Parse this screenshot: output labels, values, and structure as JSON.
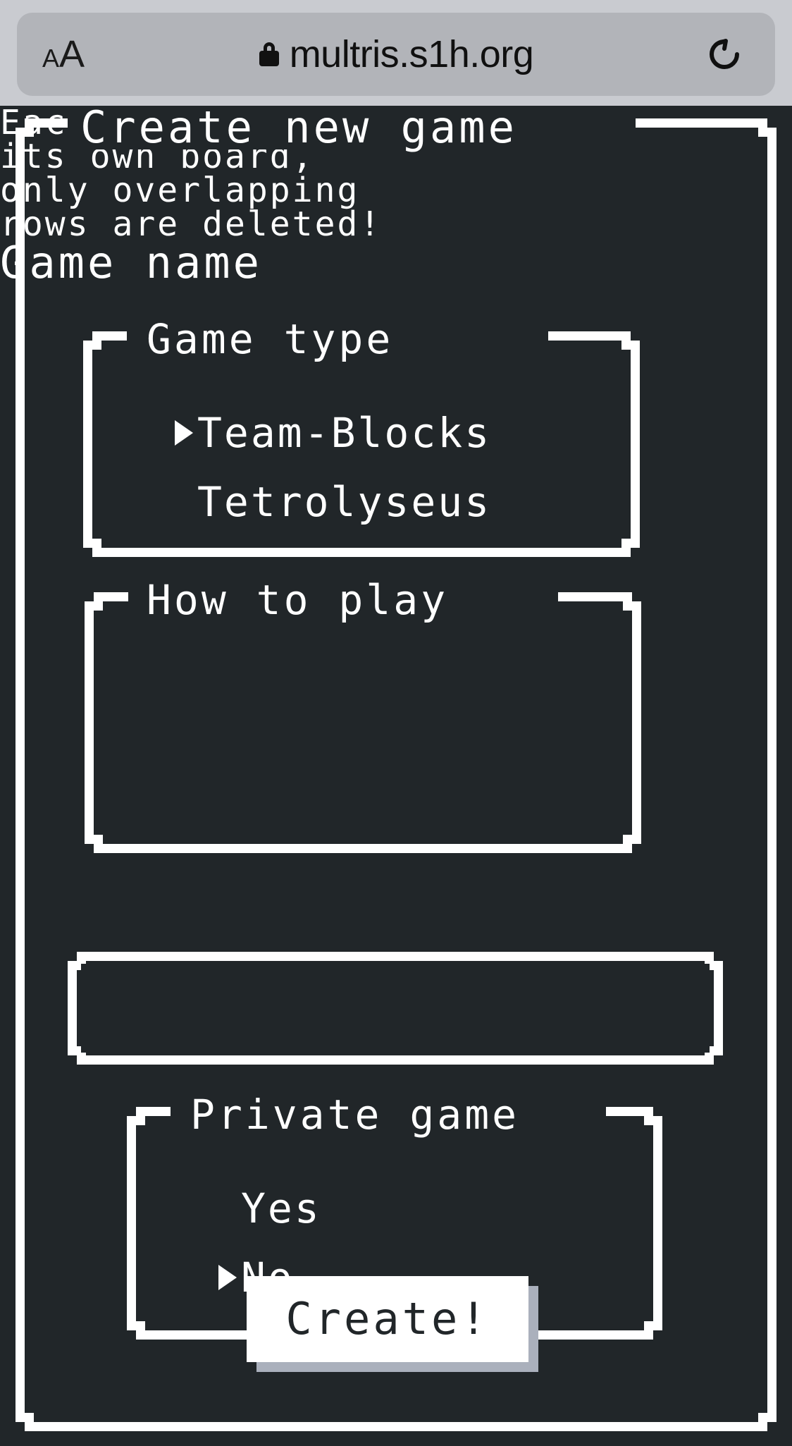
{
  "browser": {
    "text_size_small": "A",
    "text_size_large": "A",
    "url": "multris.s1h.org",
    "lock_icon": "lock-icon",
    "reload_icon": "reload-icon"
  },
  "page": {
    "title": "Create new game",
    "colors": {
      "background": "#212629",
      "foreground": "#ffffff",
      "button_shadow": "#aab0bc",
      "browser_chrome": "#c9cbd0",
      "url_pill": "#b2b4b9"
    },
    "game_type": {
      "legend": "Game type",
      "options": [
        {
          "label": "Team-Blocks",
          "selected": true
        },
        {
          "label": "Tetrolyseus",
          "selected": false
        }
      ]
    },
    "how_to_play": {
      "legend": "How to play",
      "lines": [
        "Each player has",
        "its own board,",
        "only overlapping",
        "rows are deleted!"
      ]
    },
    "game_name": {
      "label": "Game name",
      "value": "",
      "placeholder": ""
    },
    "private_game": {
      "legend": "Private game",
      "options": [
        {
          "label": "Yes",
          "selected": false
        },
        {
          "label": "No",
          "selected": true
        }
      ]
    },
    "create_button": {
      "label": "Create!"
    }
  }
}
